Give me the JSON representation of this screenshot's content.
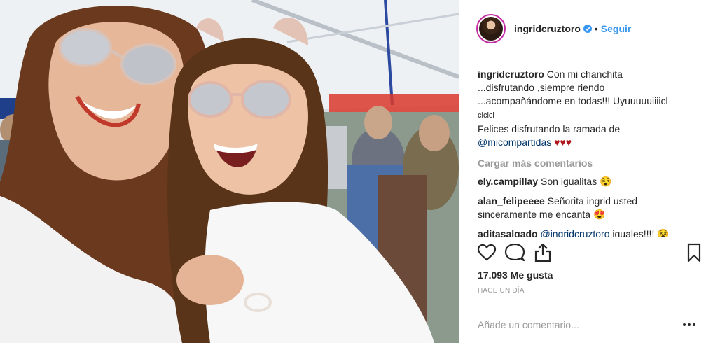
{
  "header": {
    "username": "ingridcruztoro",
    "separator": "•",
    "follow_label": "Seguir"
  },
  "caption": {
    "username": "ingridcruztoro",
    "line1": "Con mi chanchita",
    "line2": "...disfrutando ,siempre riendo",
    "line3": "...acompañándome en todas!!! Uyuuuuuiiiicl",
    "line4": "clclcl",
    "line5": "Felices disfrutando la ramada de",
    "mention": "@micompartidas",
    "hearts": "♥♥♥"
  },
  "load_more_label": "Cargar más comentarios",
  "comments": [
    {
      "username": "ely.campillay",
      "text": "Son igualitas",
      "emoji": "😵"
    },
    {
      "username": "alan_felipeeee",
      "text": "Señorita ingrid usted",
      "text2": "sinceramente me encanta",
      "emoji": "😍"
    },
    {
      "username": "aditasalgado",
      "mention": "@ingridcruztoro",
      "text": "iguales!!!!",
      "emoji": "😵"
    }
  ],
  "icons": {
    "like": "heart-outline-icon",
    "comment": "speech-bubble-icon",
    "share": "share-upload-icon",
    "save": "bookmark-icon",
    "verified": "verified-badge-icon",
    "more": "more-dots-icon"
  },
  "likes_text": "17.093 Me gusta",
  "timestamp": "HACE UN DÍA",
  "add_comment_placeholder": "Añade un comentario...",
  "colors": {
    "link": "#3897f0",
    "mention": "#003569",
    "heart": "#b0171d",
    "muted": "#999999"
  }
}
